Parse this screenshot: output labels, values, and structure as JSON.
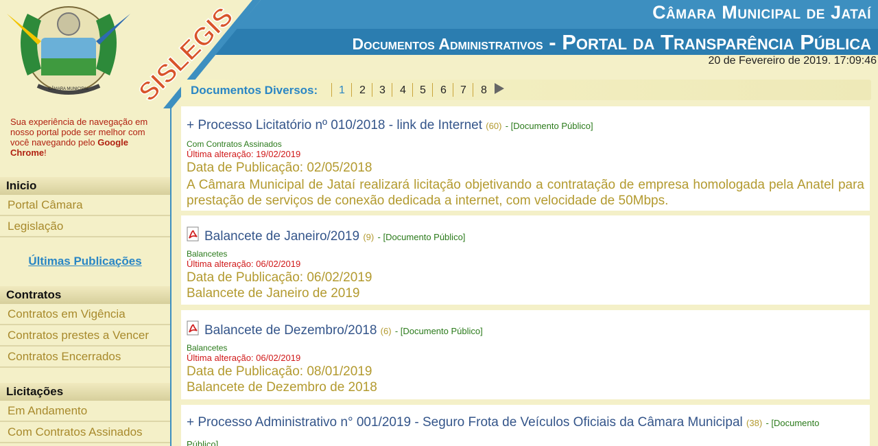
{
  "header": {
    "title": "Câmara Municipal de Jataí",
    "sub_left": "Documentos Administrativos",
    "sub_sep": " - ",
    "sub_right": "Portal da Transparência Pública",
    "datetime": "20 de Fevereiro de 2019. 17:09:46",
    "brand": "SISLEGIS",
    "seal_text": "CÂMARA MUNICIPAL"
  },
  "sidebar": {
    "notice_text": "Sua experiência de navegação em nosso portal pode ser melhor com você navegando pelo",
    "notice_browser": "Google Chrome",
    "notice_end": "!",
    "inicio": "Inicio",
    "portal_camara": "Portal Câmara",
    "legislacao": "Legislação",
    "ultimas": "Últimas Publicações",
    "contratos": "Contratos",
    "contratos_vigencia": "Contratos em Vigência",
    "contratos_prestes": "Contratos prestes a Vencer",
    "contratos_encerrados": "Contratos Encerrados",
    "licitacoes": "Licitações",
    "em_andamento": "Em Andamento",
    "com_contratos": "Com Contratos Assinados"
  },
  "pager": {
    "label": "Documentos Diversos:",
    "pages": [
      "1",
      "2",
      "3",
      "4",
      "5",
      "6",
      "7",
      "8"
    ],
    "current": "1"
  },
  "documents": [
    {
      "prefix": "+ ",
      "title": "Processo Licitatório nº 010/2018 - link de Internet",
      "count": "(60)",
      "access": "- [Documento Público]",
      "category": "Com Contratos Assinados",
      "altered": "Última alteração: 19/02/2019",
      "published": "Data de Publicação: 02/05/2018",
      "description": "A Câmara Municipal de Jataí realizará licitação objetivando a contratação de empresa homologada pela Anatel para prestação de serviços de conexão dedicada a internet, com velocidade de 50Mbps."
    },
    {
      "prefix": "",
      "title": "Balancete de Janeiro/2019",
      "count": "(9)",
      "access": "- [Documento Público]",
      "category": "Balancetes",
      "altered": "Última alteração: 06/02/2019",
      "published": "Data de Publicação: 06/02/2019",
      "description": "Balancete de Janeiro de 2019"
    },
    {
      "prefix": "",
      "title": "Balancete de Dezembro/2018",
      "count": "(6)",
      "access": "- [Documento Público]",
      "category": "Balancetes",
      "altered": "Última alteração: 06/02/2019",
      "published": "Data de Publicação: 08/01/2019",
      "description": "Balancete de Dezembro de 2018"
    },
    {
      "prefix": "+ ",
      "title": "Processo Administrativo n° 001/2019 - Seguro Frota de Veículos Oficiais da Câmara Municipal",
      "count": "(38)",
      "access": "- [Documento",
      "access_cont": "Público]"
    }
  ],
  "colors": {
    "header_blue": "#2d82b3",
    "cream": "#f4f0c8",
    "link_blue": "#2a86c4",
    "gold": "#b39a2f",
    "green": "#2a7a1a",
    "red": "#d01818"
  }
}
